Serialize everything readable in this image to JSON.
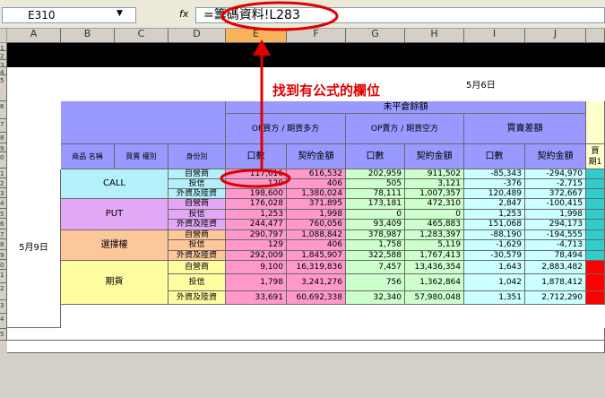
{
  "formula_bar": {
    "cell_ref": "E310",
    "fx_symbol": "fx",
    "formula": "=籌碼資料!L283"
  },
  "columns": [
    "A",
    "B",
    "C",
    "D",
    "E",
    "F",
    "G",
    "H",
    "I",
    "J"
  ],
  "selected_column": "E",
  "row_numbers": [
    "1",
    "2",
    "3",
    "4",
    "5",
    "6",
    "7",
    "8",
    "9",
    "0",
    "1",
    "2",
    "3",
    "4",
    "5",
    "6",
    "7",
    "8",
    "9",
    "0",
    "1",
    "2",
    "3",
    "4",
    "5"
  ],
  "annotation": "找到有公式的欄位",
  "date_header": "5月6日",
  "date_label": "5月9日",
  "headers": {
    "uncovered": "未平倉餘額",
    "op_long": "OP買方 / 期貨多方",
    "op_short": "OP賣方 / 期貨空方",
    "net": "買賣差額",
    "right_partial": "買",
    "right_partial2": "期1",
    "product_name": "商品 名稱",
    "buy_sell_type": "買賣 權別",
    "identity": "身份別",
    "lots": "口數",
    "contract_amount": "契約金額"
  },
  "groups": [
    {
      "name": "CALL",
      "color": "#b4f0fa",
      "rows": [
        {
          "id": "自營商",
          "v": [
            "117,616",
            "616,532",
            "202,959",
            "911,502",
            "-85,343",
            "-294,970"
          ]
        },
        {
          "id": "投信",
          "v": [
            "129",
            "406",
            "505",
            "3,121",
            "-376",
            "-2,715"
          ]
        },
        {
          "id": "外資及陸資",
          "v": [
            "198,600",
            "1,380,024",
            "78,111",
            "1,007,357",
            "120,489",
            "372,667"
          ]
        }
      ]
    },
    {
      "name": "PUT",
      "color": "#e3a8f5",
      "rows": [
        {
          "id": "自營商",
          "v": [
            "176,028",
            "371,895",
            "173,181",
            "472,310",
            "2,847",
            "-100,415"
          ]
        },
        {
          "id": "投信",
          "v": [
            "1,253",
            "1,998",
            "0",
            "0",
            "1,253",
            "1,998"
          ]
        },
        {
          "id": "外資及陸資",
          "v": [
            "244,477",
            "760,056",
            "93,409",
            "465,883",
            "151,068",
            "294,173"
          ]
        }
      ]
    },
    {
      "name": "選擇權",
      "color": "#fcc89a",
      "rows": [
        {
          "id": "自營商",
          "v": [
            "290,797",
            "1,088,842",
            "378,987",
            "1,283,397",
            "-88,190",
            "-194,555"
          ]
        },
        {
          "id": "投信",
          "v": [
            "129",
            "406",
            "1,758",
            "5,119",
            "-1,629",
            "-4,713"
          ]
        },
        {
          "id": "外資及陸資",
          "v": [
            "292,009",
            "1,845,907",
            "322,588",
            "1,767,413",
            "-30,579",
            "78,494"
          ]
        }
      ]
    },
    {
      "name": "期貨",
      "color": "#fefea0",
      "rows": [
        {
          "id": "自營商",
          "v": [
            "9,100",
            "16,319,836",
            "7,457",
            "13,436,354",
            "1,643",
            "2,883,482"
          ]
        },
        {
          "id": "投信",
          "v": [
            "1,798",
            "3,241,276",
            "756",
            "1,362,864",
            "1,042",
            "1,878,412"
          ]
        },
        {
          "id": "外資及陸資",
          "v": [
            "33,691",
            "60,692,338",
            "32,340",
            "57,980,048",
            "1,351",
            "2,712,290"
          ]
        }
      ]
    }
  ],
  "colors": {
    "header_purple": "#9999ff",
    "long_pink": "#ff99cc",
    "short_green": "#ccffcc",
    "net_cyan": "#ccffff",
    "annotation_red": "#e00000",
    "right_teal": "#33cccc",
    "right_red": "#ff0000"
  }
}
